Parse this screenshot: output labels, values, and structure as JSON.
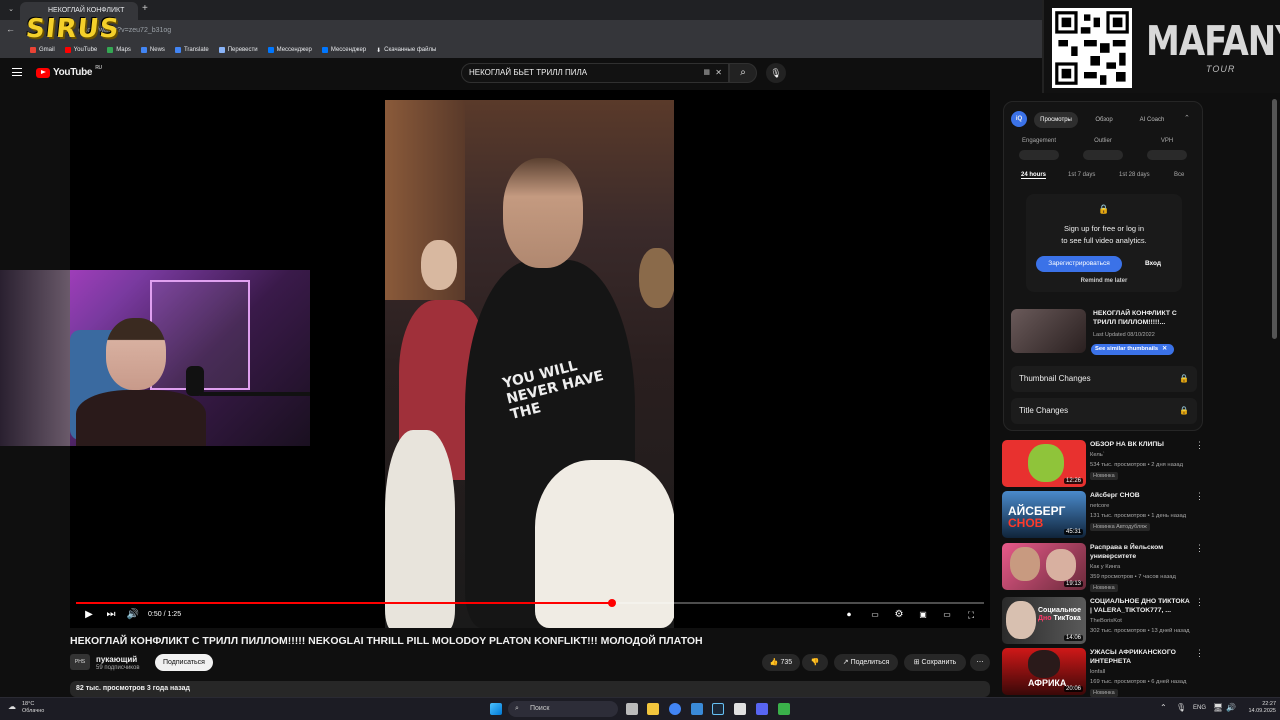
{
  "browser": {
    "tab_title": "НЕКОГЛАЙ КОНФЛИКТ С",
    "url": "e.com/watch?v=zeu72_b31og",
    "bookmarks": [
      "Gmail",
      "YouTube",
      "Maps",
      "News",
      "Translate",
      "Перевести",
      "Мессенджер",
      "Мессенджер",
      "Скачанные файлы"
    ]
  },
  "overlay": {
    "sirus_logo": "SIRUS",
    "banner_title": "MAFANYA",
    "banner_sub": "TOUR"
  },
  "youtube": {
    "logo": "YouTube",
    "logo_region": "RU",
    "search_value": "НЕКОГЛАЙ БЬЕТ ТРИЛЛ ПИЛА"
  },
  "player": {
    "time": "0:50 / 1:25",
    "progress": 0.59
  },
  "video": {
    "title": "НЕКОГЛАЙ КОНФЛИКТ С ТРИЛЛ ПИЛЛОМ!!!!! NEKOGLAI THRILL PILL MOLODOY PLATON KONFLIKT!!! МОЛОДОЙ ПЛАТОН",
    "channel": "пукающий",
    "subscribers": "59 подписчиков",
    "subscribe_label": "Подписаться",
    "likes": "735",
    "share_label": "Поделиться",
    "save_label": "Сохранить",
    "description_meta": "82 тыс. просмотров  3 года назад",
    "shirt_text": "YOU WILL NEVER HAVE THE"
  },
  "panel": {
    "tabs": [
      "Просмотры",
      "Обзор",
      "AI Coach"
    ],
    "metrics": [
      "Engagement",
      "Outlier",
      "VPH"
    ],
    "ranges": [
      "24 hours",
      "1st 7 days",
      "1st 28 days",
      "Все"
    ],
    "lock_line1": "Sign up for free or log in",
    "lock_line2": "to see full video analytics.",
    "signup": "Зарегистрироваться",
    "login": "Вход",
    "remind": "Remind me later",
    "video_title": "НЕКОГЛАЙ КОНФЛИКТ С ТРИЛЛ ПИЛЛОМ!!!!!...",
    "last_updated": "Last Updated 08/10/2022",
    "similar": "See similar thumbnails",
    "thumbnail_changes": "Thumbnail Changes",
    "title_changes": "Title Changes"
  },
  "recommendations": [
    {
      "title": "ОБЗОР НА ВК КЛИПЫ",
      "channel": "Кель`",
      "meta": "534 тыс. просмотров • 2 дня назад",
      "badge": "Новинка",
      "duration": "12:26",
      "color": "#e8312f"
    },
    {
      "title": "Айсберг СНОВ",
      "channel": "netcore",
      "meta": "131 тыс. просмотров • 1 день назад",
      "badge": "Новинка   Автодубляж",
      "duration": "45:31",
      "color": "#1e4a7a"
    },
    {
      "title": "Расправа в Йельском университете",
      "channel": "Как у Кинга",
      "meta": "359 просмотров • 7 часов назад",
      "badge": "Новинка",
      "duration": "19:13",
      "color": "#c23a5a"
    },
    {
      "title": "СОЦИАЛЬНОЕ ДНО ТИКТОКА | VALERA_TIKTOK777, ...",
      "channel": "TheBorisKot",
      "meta": "302 тыс. просмотров • 13 дней назад",
      "badge": "",
      "duration": "14:06",
      "color": "#3a3a3a"
    },
    {
      "title": "УЖАСЫ АФРИКАНСКОГО ИНТЕРНЕТА",
      "channel": "lonfall",
      "meta": "169 тыс. просмотров • 6 дней назад",
      "badge": "Новинка",
      "duration": "20:06",
      "color": "#b01818"
    }
  ],
  "taskbar": {
    "weather_temp": "18°C",
    "weather_desc": "Облачно",
    "search": "Поиск",
    "lang": "ENG",
    "time": "22:27",
    "date": "14.09.2025"
  }
}
